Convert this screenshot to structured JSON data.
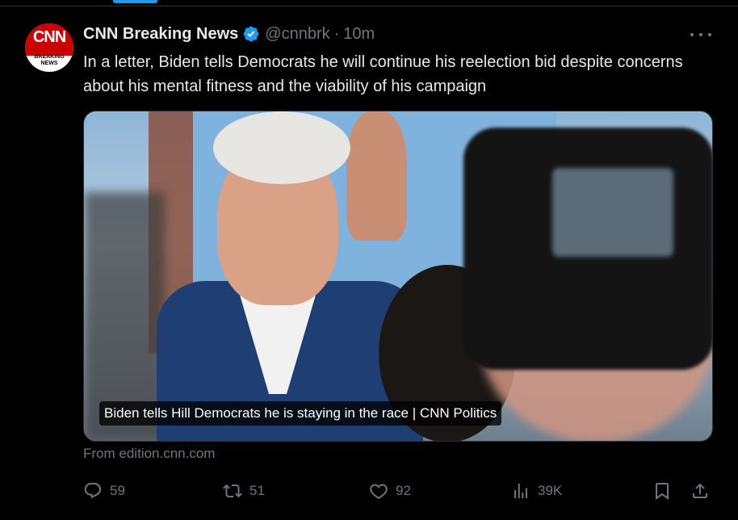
{
  "tweet": {
    "author_name": "CNN Breaking News",
    "handle": "@cnnbrk",
    "separator": "·",
    "time": "10m",
    "text": "In a letter, Biden tells Democrats he will continue his reelection bid despite concerns about his mental fitness and the viability of his campaign",
    "avatar": {
      "logo_text": "CNN",
      "sub_text": "BREAKING NEWS"
    },
    "card": {
      "caption": "Biden tells Hill Democrats he is staying in the race | CNN Politics",
      "source": "From edition.cnn.com"
    },
    "actions": {
      "replies": "59",
      "reposts": "51",
      "likes": "92",
      "views": "39K"
    }
  },
  "colors": {
    "background": "#000000",
    "text_primary": "#e7e9ea",
    "text_secondary": "#71767b",
    "verified_blue": "#1d9bf0",
    "cnn_red": "#cc0000"
  },
  "icons": [
    "verified-badge-icon",
    "more-options-icon",
    "reply-icon",
    "repost-icon",
    "like-icon",
    "views-icon",
    "bookmark-icon",
    "share-icon"
  ]
}
